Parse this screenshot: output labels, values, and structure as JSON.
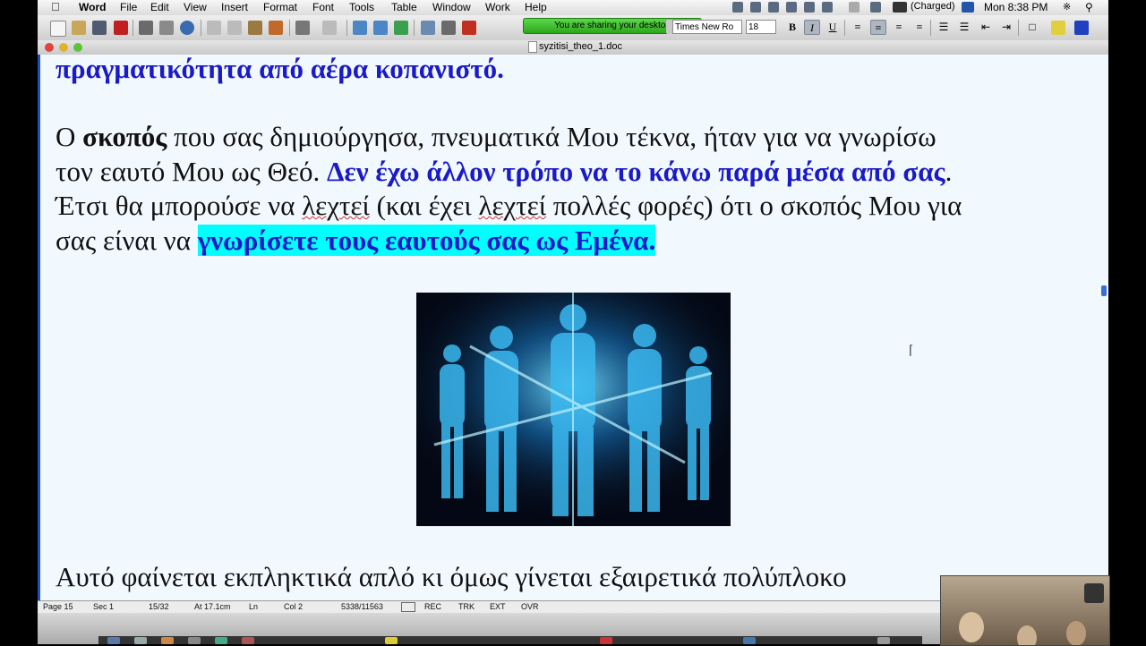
{
  "menubar": {
    "app_name": "Word",
    "menus": [
      "File",
      "Edit",
      "View",
      "Insert",
      "Format",
      "Font",
      "Tools",
      "Table",
      "Window",
      "Work",
      "Help"
    ],
    "battery": "(Charged)",
    "clock": "Mon 8:38 PM"
  },
  "toolbar": {
    "sharing_text": "You are sharing your desktop",
    "font_name": "Times New Ro",
    "font_size": "18",
    "bold": "B",
    "italic": "I",
    "underline": "U"
  },
  "window": {
    "title": "syzitisi_theo_1.doc"
  },
  "document": {
    "line0": "πραγματικότητα από αέρα κοπανιστό.",
    "p1_a": "Ο ",
    "p1_b": "σκοπός",
    "p1_c": " που σας δημιούργησα, πνευματικά Μου τέκνα, ήταν για να γνωρίσω",
    "p2_a": "τον εαυτό Μου ως Θεό. ",
    "p2_b": "Δεν έχω άλλον τρόπο να το κάνω παρά μέσα από σας",
    "p2_c": ".",
    "p3_a": "Έτσι θα μπορούσε να ",
    "p3_b": "λεχτεί",
    "p3_c": " (και έχει ",
    "p3_d": "λεχτεί",
    "p3_e": " πολλές φορές) ότι ο σκοπός Μου για",
    "p4_a": "σας είναι να ",
    "p4_b": "γνωρίσετε τους εαυτούς σας ως Εμένα.",
    "p5": "Αυτό φαίνεται εκπληκτικά απλό κι όμως γίνεται εξαιρετικά πολύπλοκο"
  },
  "statusbar": {
    "page": "Page 15",
    "sec": "Sec 1",
    "pages": "15/32",
    "at": "At 17.1cm",
    "ln": "Ln",
    "col": "Col 2",
    "words": "5338/11563",
    "rec": "REC",
    "trk": "TRK",
    "ext": "EXT",
    "ovr": "OVR"
  },
  "colors": {
    "doc_background": "#f2f9fe",
    "emphasis_blue": "#1a1ac8",
    "highlight": "#00ffff"
  }
}
